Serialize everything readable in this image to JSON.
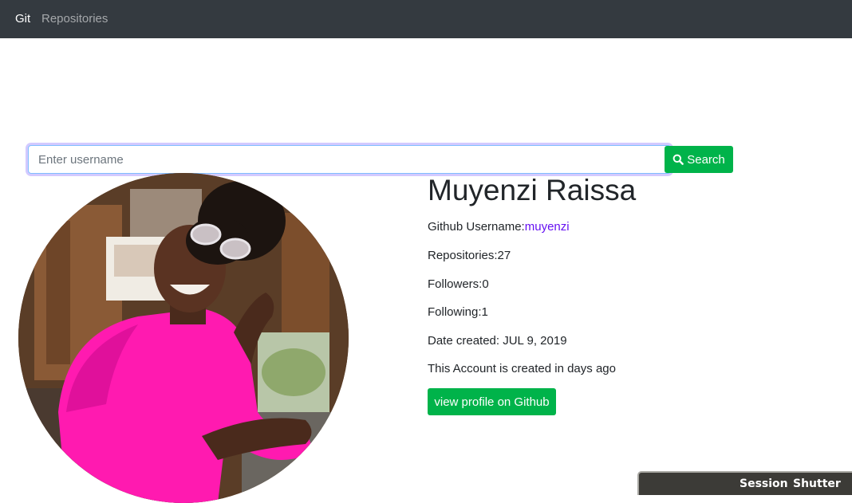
{
  "navbar": {
    "brand": "Git",
    "links": [
      "Repositories"
    ]
  },
  "search": {
    "placeholder": "Enter username",
    "value": "",
    "button_label": "Search",
    "button_icon": "search-icon"
  },
  "profile": {
    "name": "Muyenzi Raissa",
    "username_label": "Github Username:",
    "username": "muyenzi",
    "repositories": "Repositories:27",
    "followers": "Followers:0",
    "following": "Following:1",
    "date_created": "Date created: JUL 9, 2019",
    "account_age": "This Account is created in days ago",
    "view_button": "view profile on Github"
  },
  "taskbar": {
    "items": [
      "Session",
      "Shutter"
    ]
  },
  "colors": {
    "navbar": "#343a40",
    "accent_green": "#00b34a",
    "link": "#6610f2"
  }
}
